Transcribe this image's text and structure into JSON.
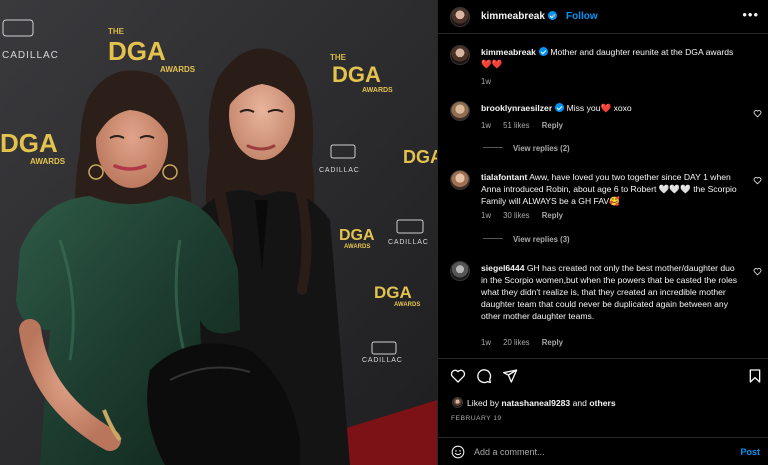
{
  "photo": {
    "backdrop_logos": [
      "DGA",
      "THE",
      "AWARDS",
      "CADILLAC"
    ]
  },
  "header": {
    "username": "kimmeabreak",
    "separator": "•",
    "follow_label": "Follow",
    "more_label": "•••"
  },
  "caption": {
    "username": "kimmeabreak",
    "text": "Mother and daughter reunite at the DGA awards",
    "emoji": "❤️❤️",
    "time": "1w"
  },
  "comments": [
    {
      "username": "brooklynraesilzer",
      "verified": true,
      "text": "Miss you",
      "emoji": "❤️",
      "text_after": "xoxo",
      "time": "1w",
      "likes": "51 likes",
      "reply": "Reply",
      "view_replies": "View replies (2)"
    },
    {
      "username": "tialafontant",
      "text": "Aww, have loved you two together since DAY 1 when Anna introduced Robin, about age 6 to Robert",
      "emoji": "🤍🤍🤍",
      "text_after": "the Scorpio Family will ALWAYS be a GH FAV",
      "emoji_end": "🥰",
      "time": "1w",
      "likes": "30 likes",
      "reply": "Reply",
      "view_replies": "View replies (3)"
    },
    {
      "username": "siegel6444",
      "text": "GH has created not only the best mother/daughter duo in the Scorpio women,but when the powers that be casted the roles what they didn't realize is, that they created an incredible mother daughter team that could never be duplicated again between any other mother daughter teams.",
      "time": "1w",
      "likes": "20 likes",
      "reply": "Reply"
    }
  ],
  "actions": {
    "liked_prefix": "Liked by",
    "liked_user": "natashaneal9283",
    "liked_and": "and",
    "liked_others": "others",
    "date": "FEBRUARY 19"
  },
  "add_comment": {
    "placeholder": "Add a comment...",
    "post_label": "Post"
  },
  "colors": {
    "accent": "#0095f6",
    "heart": "#ff3040",
    "muted": "#a8a8a8"
  },
  "icons": [
    "more-icon",
    "verified-icon",
    "heart-icon",
    "comment-icon",
    "share-icon",
    "bookmark-icon",
    "emoji-icon"
  ]
}
